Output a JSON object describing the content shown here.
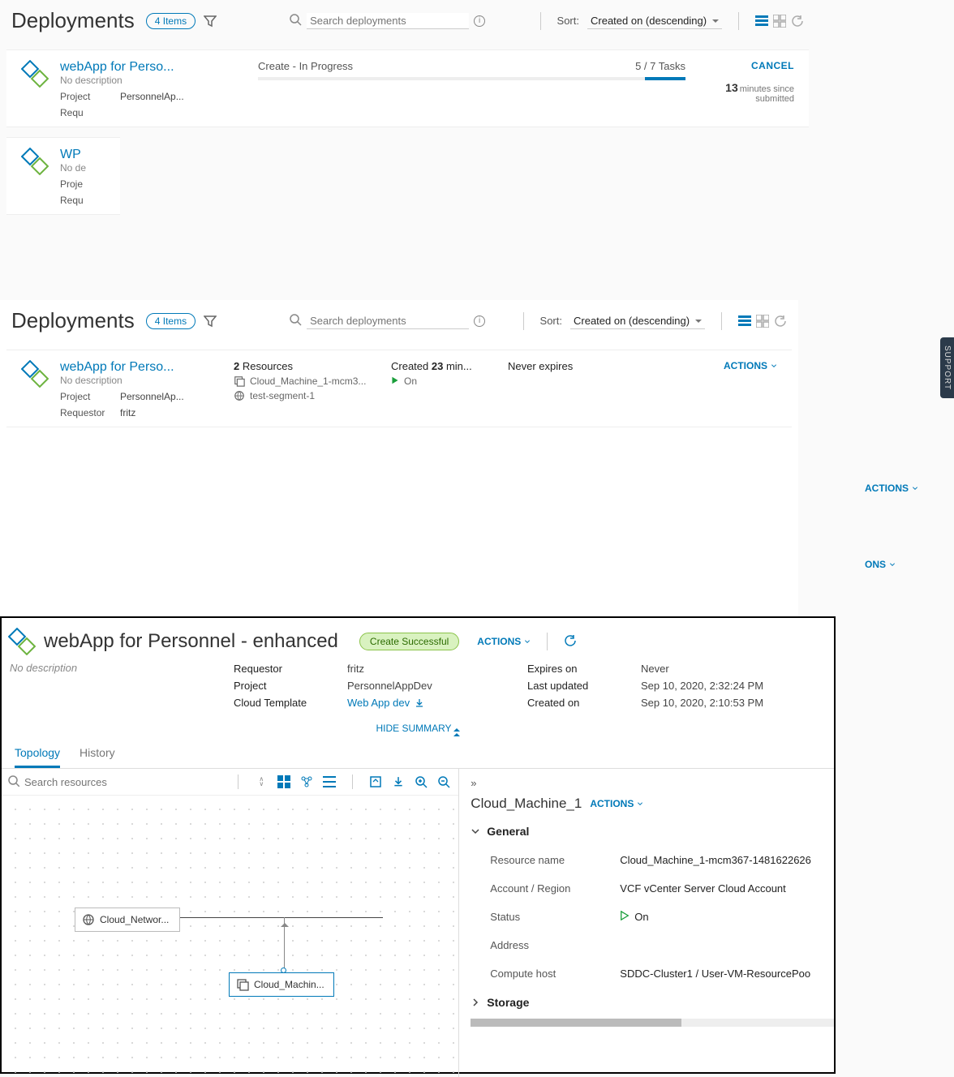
{
  "support_label": "SUPPORT",
  "deployments_label": "Deployments",
  "items_pill": "4 Items",
  "search_placeholder": "Search deployments",
  "sort_label": "Sort:",
  "sort_value": "Created on (descending)",
  "actions_label": "ACTIONS",
  "pane1": {
    "card1": {
      "name": "webApp for Perso...",
      "sub": "No description",
      "project_label": "Project",
      "project_value": "PersonnelAp...",
      "requestor_label": "Requ",
      "status": "Create - In Progress",
      "tasks": "5 / 7  Tasks",
      "cancel": "CANCEL",
      "mins_num": "13",
      "mins_txt": "minutes since submitted"
    },
    "card2": {
      "name": "WP",
      "sub": "No de",
      "project_label": "Proje",
      "requestor_label": "Requ"
    }
  },
  "pane2": {
    "card": {
      "name": "webApp for Perso...",
      "sub": "No description",
      "project_label": "Project",
      "project_value": "PersonnelAp...",
      "requestor_label": "Requestor",
      "requestor_value": "fritz",
      "resources_num": "2",
      "resources_txt": "Resources",
      "res1": "Cloud_Machine_1-mcm3...",
      "res2": "test-segment-1",
      "created_txt": "Created",
      "created_num": "23",
      "created_unit": "min...",
      "status": "On",
      "expires": "Never expires"
    }
  },
  "pane3": {
    "title": "webApp for Personnel - enhanced",
    "status_pill": "Create Successful",
    "no_desc": "No description",
    "summary": {
      "left": {
        "requestor_l": "Requestor",
        "requestor_v": "fritz",
        "project_l": "Project",
        "project_v": "PersonnelAppDev",
        "cloudtpl_l": "Cloud Template",
        "cloudtpl_v": "Web App dev"
      },
      "right": {
        "expires_l": "Expires on",
        "expires_v": "Never",
        "updated_l": "Last updated",
        "updated_v": "Sep 10, 2020, 2:32:24 PM",
        "created_l": "Created on",
        "created_v": "Sep 10, 2020, 2:10:53 PM"
      }
    },
    "hide_summary": "HIDE SUMMARY",
    "tabs": {
      "topology": "Topology",
      "history": "History"
    },
    "search_resources": "Search resources",
    "nodes": {
      "network": "Cloud_Networ...",
      "machine": "Cloud_Machin..."
    },
    "inspector": {
      "title": "Cloud_Machine_1",
      "section_general": "General",
      "resource_name_l": "Resource name",
      "resource_name_v": "Cloud_Machine_1-mcm367-1481622626",
      "account_l": "Account / Region",
      "account_v": "VCF vCenter Server Cloud Account",
      "status_l": "Status",
      "status_v": "On",
      "address_l": "Address",
      "address_v": "",
      "compute_l": "Compute host",
      "compute_v": "SDDC-Cluster1 / User-VM-ResourcePoo",
      "section_storage": "Storage"
    },
    "expand_glyph": "»"
  }
}
